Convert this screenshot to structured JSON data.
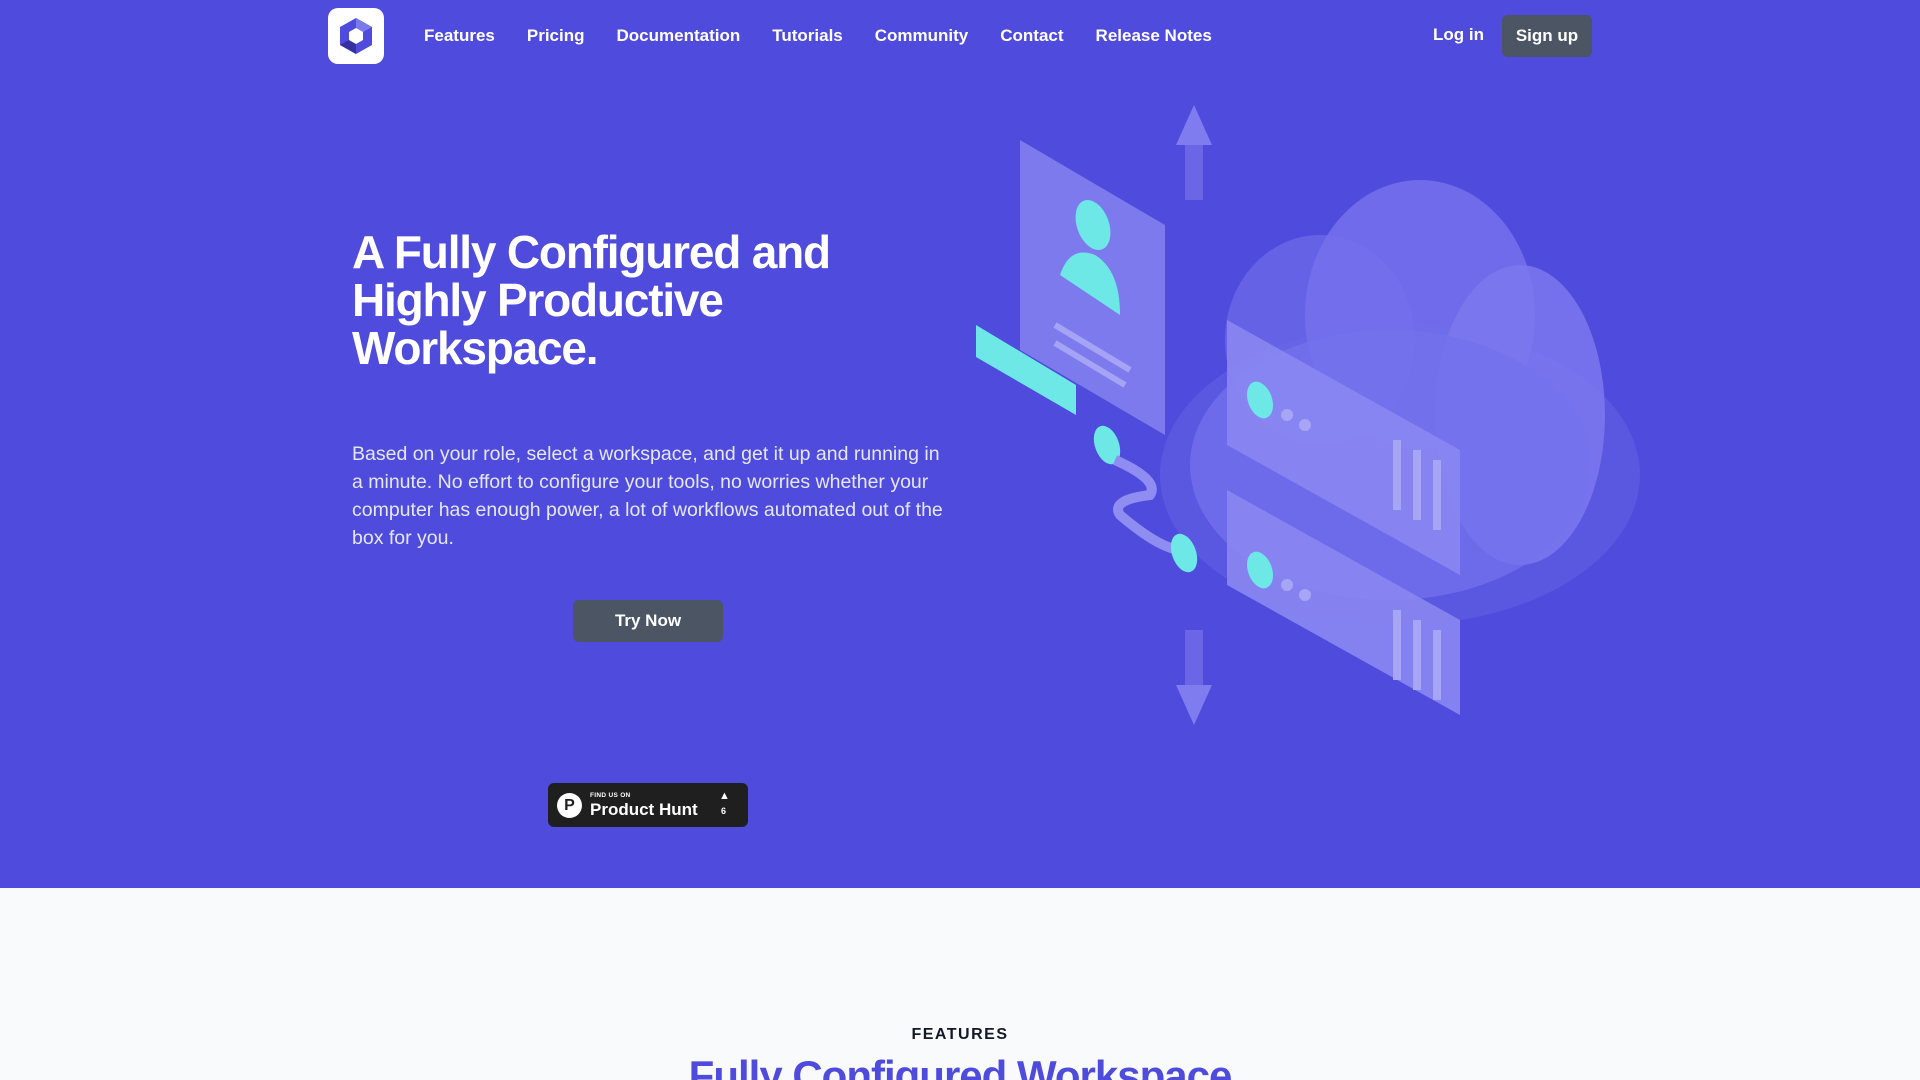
{
  "nav": {
    "links": [
      "Features",
      "Pricing",
      "Documentation",
      "Tutorials",
      "Community",
      "Contact",
      "Release Notes"
    ],
    "login": "Log in",
    "signup": "Sign up"
  },
  "hero": {
    "headline": "A Fully Configured and Highly Productive Workspace.",
    "lead": "Based on your role, select a workspace, and get it up and running in a minute. No effort to configure your tools, no worries whether your computer has enough power, a lot of workflows automated out of the box for you.",
    "cta": "Try Now"
  },
  "product_hunt": {
    "small_text": "FIND US ON",
    "name": "Product Hunt",
    "logo_letter": "P",
    "arrow": "▲",
    "count": "6"
  },
  "features": {
    "label": "FEATURES",
    "title": "Fully Configured Workspace"
  },
  "colors": {
    "brand": "#4f4bdd",
    "button": "#4b5563",
    "accent": "#6ee7e7"
  }
}
